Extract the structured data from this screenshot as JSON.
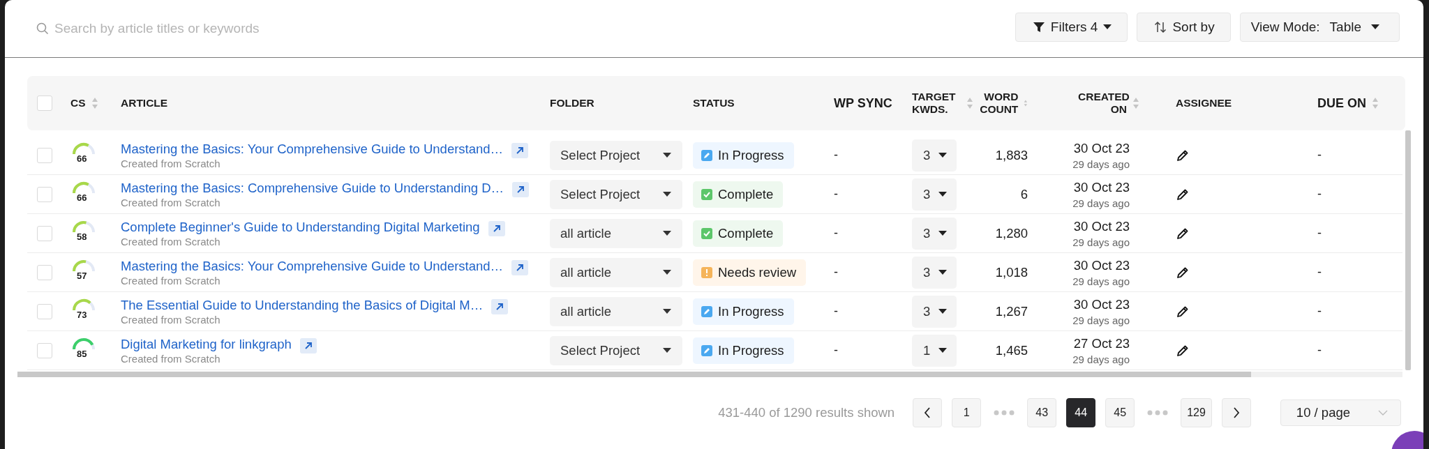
{
  "search": {
    "placeholder": "Search by article titles or keywords"
  },
  "toolbar": {
    "filters": "Filters 4",
    "sort": "Sort by",
    "view_mode_label": "View Mode:",
    "view_mode_value": "Table"
  },
  "table": {
    "select_all": {
      "checked": false
    },
    "columns": [
      {
        "label": "CS",
        "sortable": true
      },
      {
        "label": "ARTICLE",
        "sortable": false
      },
      {
        "label": "FOLDER",
        "sortable": false
      },
      {
        "label": "STATUS",
        "sortable": false
      },
      {
        "label": "WP SYNC",
        "sortable": false
      },
      {
        "label": "TARGET KWDS.",
        "sortable": true
      },
      {
        "label": "WORD COUNT",
        "sortable": true
      },
      {
        "label": "CREATED ON",
        "sortable": true
      },
      {
        "label": "ASSIGNEE",
        "sortable": false
      },
      {
        "label": "DUE ON",
        "sortable": true
      }
    ],
    "rows": [
      {
        "checked": false,
        "cs": "66",
        "level": 0.66,
        "title": "Mastering the Basics: Your Comprehensive Guide to Understand…",
        "source": "Created from Scratch",
        "folder": "Select Project",
        "status": {
          "kind": "in_progress",
          "label": "In Progress"
        },
        "wp_sync": "-",
        "target_kwds": "3",
        "word_count": "1,883",
        "created": "30 Oct 23",
        "created_ago": "29 days ago",
        "due_on": "-"
      },
      {
        "checked": false,
        "cs": "66",
        "level": 0.66,
        "title": "Mastering the Basics: Comprehensive Guide to Understanding D…",
        "source": "Created from Scratch",
        "folder": "Select Project",
        "status": {
          "kind": "complete",
          "label": "Complete"
        },
        "wp_sync": "-",
        "target_kwds": "3",
        "word_count": "6",
        "created": "30 Oct 23",
        "created_ago": "29 days ago",
        "due_on": "-"
      },
      {
        "checked": false,
        "cs": "58",
        "level": 0.58,
        "title": "Complete Beginner's Guide to Understanding Digital Marketing",
        "source": "Created from Scratch",
        "folder": "all article",
        "status": {
          "kind": "complete",
          "label": "Complete"
        },
        "wp_sync": "-",
        "target_kwds": "3",
        "word_count": "1,280",
        "created": "30 Oct 23",
        "created_ago": "29 days ago",
        "due_on": "-"
      },
      {
        "checked": false,
        "cs": "57",
        "level": 0.57,
        "title": "Mastering the Basics: Your Comprehensive Guide to Understand…",
        "source": "Created from Scratch",
        "folder": "all article",
        "status": {
          "kind": "needs_review",
          "label": "Needs review"
        },
        "wp_sync": "-",
        "target_kwds": "3",
        "word_count": "1,018",
        "created": "30 Oct 23",
        "created_ago": "29 days ago",
        "due_on": "-"
      },
      {
        "checked": false,
        "cs": "73",
        "level": 0.73,
        "title": "The Essential Guide to Understanding the Basics of Digital M…",
        "source": "Created from Scratch",
        "folder": "all article",
        "status": {
          "kind": "in_progress",
          "label": "In Progress"
        },
        "wp_sync": "-",
        "target_kwds": "3",
        "word_count": "1,267",
        "created": "30 Oct 23",
        "created_ago": "29 days ago",
        "due_on": "-"
      },
      {
        "checked": false,
        "cs": "85",
        "level": 0.85,
        "title": "Digital Marketing for linkgraph",
        "source": "Created from Scratch",
        "folder": "Select Project",
        "status": {
          "kind": "in_progress",
          "label": "In Progress"
        },
        "wp_sync": "-",
        "target_kwds": "1",
        "word_count": "1,465",
        "created": "27 Oct 23",
        "created_ago": "29 days ago",
        "due_on": "-"
      }
    ]
  },
  "pagination": {
    "summary": "431-440 of 1290 results shown",
    "items": [
      {
        "kind": "prev"
      },
      {
        "kind": "page",
        "label": "1",
        "selected": false
      },
      {
        "kind": "gap"
      },
      {
        "kind": "page",
        "label": "43",
        "selected": false
      },
      {
        "kind": "page",
        "label": "44",
        "selected": true
      },
      {
        "kind": "page",
        "label": "45",
        "selected": false
      },
      {
        "kind": "gap"
      },
      {
        "kind": "page",
        "label": "129",
        "selected": false
      },
      {
        "kind": "next"
      }
    ],
    "page_size": "10 / page"
  }
}
